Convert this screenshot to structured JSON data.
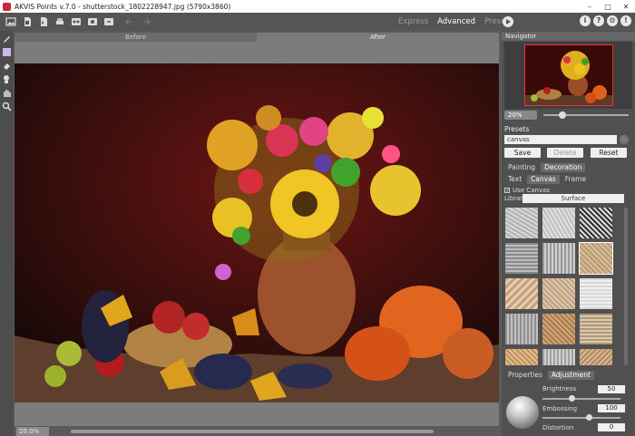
{
  "window": {
    "title": "AKVIS Points v.7.0 - shutterstock_1802228947.jpg (5790x3860)",
    "minimize": "–",
    "maximize": "□",
    "close": "✕"
  },
  "toolbar": {
    "modes": [
      "Express",
      "Advanced",
      "Presets"
    ],
    "active_mode": "Advanced",
    "icons": [
      "open-image-icon",
      "open-file-icon",
      "save-file-icon",
      "print-icon",
      "batch-icon",
      "share-icon",
      "plugin-icon",
      "undo-icon",
      "redo-icon"
    ],
    "help_icons": [
      "info-icon",
      "help-icon",
      "settings-icon",
      "news-icon"
    ]
  },
  "view_tabs": {
    "before": "Before",
    "after": "After"
  },
  "status": {
    "zoom": "20.0%"
  },
  "navigator": {
    "title": "Navigator",
    "zoom": "20%"
  },
  "presets": {
    "label": "Presets",
    "selected": "canvas",
    "save": "Save",
    "delete": "Delete",
    "reset": "Reset"
  },
  "tabs": {
    "painting": "Painting",
    "decoration": "Decoration",
    "text": "Text",
    "canvas": "Canvas",
    "frame": "Frame"
  },
  "canvas_settings": {
    "use_canvas_label": "Use Canvas",
    "use_canvas": true,
    "library_label": "Library",
    "library": "Surface"
  },
  "properties": {
    "tab_properties": "Properties",
    "tab_adjustment": "Adjustment",
    "brightness_label": "Brightness",
    "brightness": "50",
    "embossing_label": "Embossing",
    "embossing": "100",
    "distortion_label": "Distortion",
    "distortion": "0"
  },
  "colors": {
    "toolbar_bg": "#555555",
    "panel_bg": "#505050",
    "canvas_bg": "#7c7c7c",
    "active_text": "#ffffff"
  }
}
